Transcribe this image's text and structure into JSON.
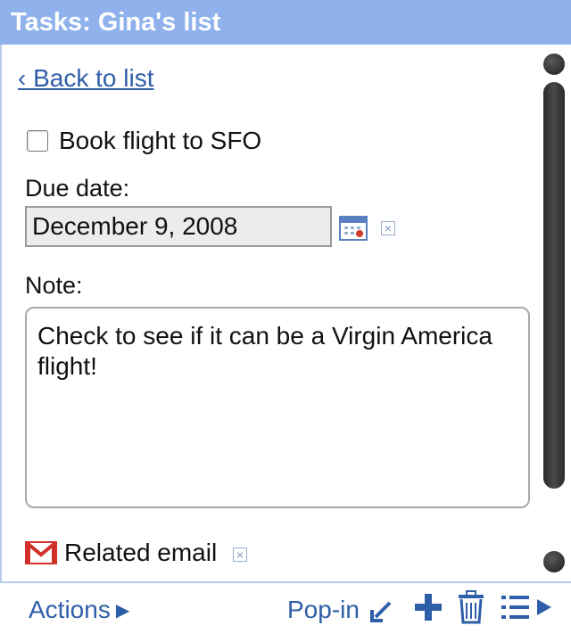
{
  "window": {
    "title": "Tasks: Gina's list"
  },
  "nav": {
    "back_label": "‹ Back to list"
  },
  "task": {
    "title": "Book flight to SFO",
    "completed": false,
    "due_label": "Due date:",
    "due_value": "December 9, 2008",
    "note_label": "Note:",
    "note_value": "Check to see if it can be a Virgin America flight!",
    "related_label": "Related email"
  },
  "footer": {
    "actions_label": "Actions",
    "popin_label": "Pop-in"
  },
  "icons": {
    "calendar": "calendar-icon",
    "clear": "clear-x-icon",
    "gmail": "gmail-icon",
    "add": "plus-icon",
    "delete": "trash-icon",
    "list": "list-icon",
    "popin": "popin-arrow-icon"
  },
  "colors": {
    "titlebar": "#8fb1ec",
    "link": "#2f5ea8",
    "accent": "#2f5ea8"
  }
}
